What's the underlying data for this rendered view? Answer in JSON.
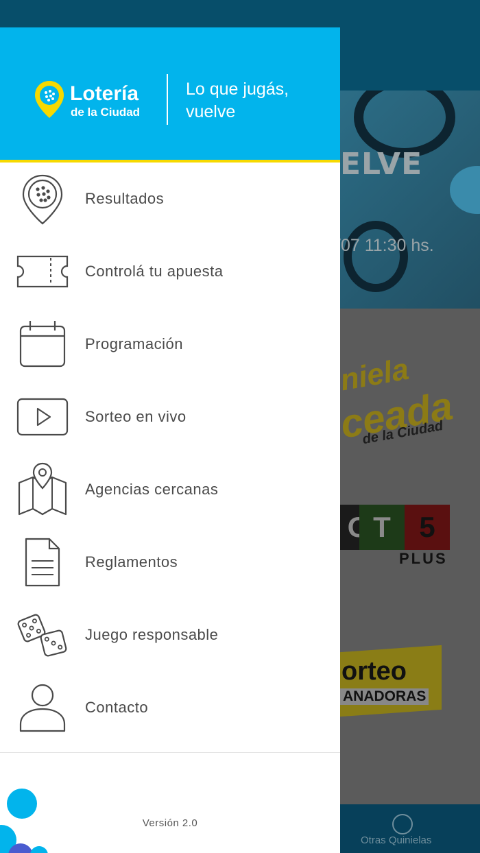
{
  "colors": {
    "accent": "#02b4ec",
    "stripe": "#f7d900",
    "text": "#4a4a4a",
    "header_text": "#ffffff"
  },
  "header": {
    "logo_title": "Lotería",
    "logo_subtitle": "de la Ciudad",
    "tagline_line1": "Lo que jugás,",
    "tagline_line2": "vuelve"
  },
  "menu": {
    "items": [
      {
        "label": "Resultados",
        "icon": "location-ball-icon"
      },
      {
        "label": "Controlá tu apuesta",
        "icon": "ticket-icon"
      },
      {
        "label": "Programación",
        "icon": "calendar-icon"
      },
      {
        "label": "Sorteo en vivo",
        "icon": "play-video-icon"
      },
      {
        "label": "Agencias cercanas",
        "icon": "map-pin-icon"
      },
      {
        "label": "Reglamentos",
        "icon": "document-icon"
      },
      {
        "label": "Juego responsable",
        "icon": "dice-icon"
      },
      {
        "label": "Contacto",
        "icon": "user-icon"
      }
    ]
  },
  "footer": {
    "version": "Versión 2.0"
  },
  "background": {
    "banner_title": "ELVE",
    "banner_date": "/07 11:30 hs.",
    "quiniela_line1": "niela",
    "quiniela_line2": "ceada",
    "quiniela_line3": "de la Ciudad",
    "loto_cells": [
      "O",
      "T",
      "5"
    ],
    "loto_plus": "PLUS",
    "sorteo_line1": "orteo",
    "sorteo_line2": "ANADORAS",
    "bottom_nav_label": "Otras Quinielas"
  }
}
